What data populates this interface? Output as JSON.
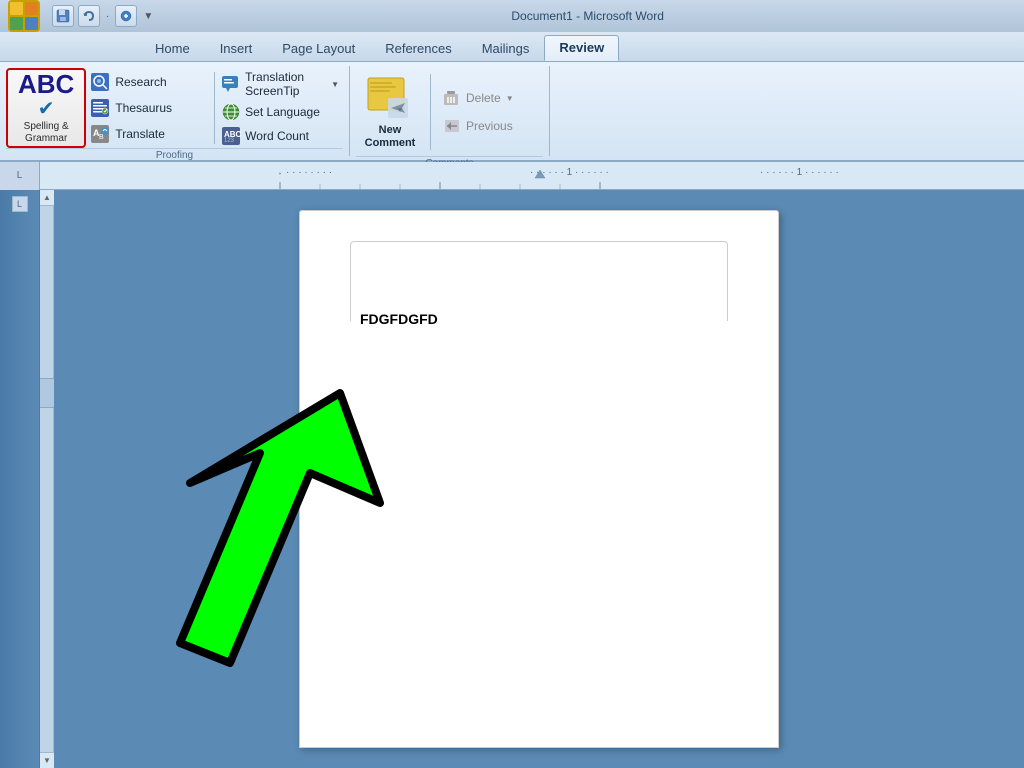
{
  "titlebar": {
    "title": "Document1 - Microsoft Word",
    "save_tooltip": "Save",
    "undo_tooltip": "Undo",
    "redo_tooltip": "Redo"
  },
  "tabs": {
    "items": [
      {
        "label": "Home",
        "active": false
      },
      {
        "label": "Insert",
        "active": false
      },
      {
        "label": "Page Layout",
        "active": false
      },
      {
        "label": "References",
        "active": false
      },
      {
        "label": "Mailings",
        "active": false
      },
      {
        "label": "Review",
        "active": true
      }
    ]
  },
  "ribbon": {
    "proofing_group_label": "Proofing",
    "spelling_label_line1": "Spelling &",
    "spelling_label_line2": "Grammar",
    "spelling_abc": "ABC",
    "research_label": "Research",
    "thesaurus_label": "Thesaurus",
    "translate_label": "Translate",
    "translation_screentip_label": "Translation ScreenTip",
    "set_language_label": "Set Language",
    "word_count_label": "Word Count",
    "comments_group_label": "Comments",
    "new_comment_label": "New\nComment",
    "delete_label": "Delete",
    "previous_label": "Previous"
  },
  "ruler": {
    "corner_symbol": "L"
  },
  "document": {
    "text": "FDGFDGFD"
  }
}
